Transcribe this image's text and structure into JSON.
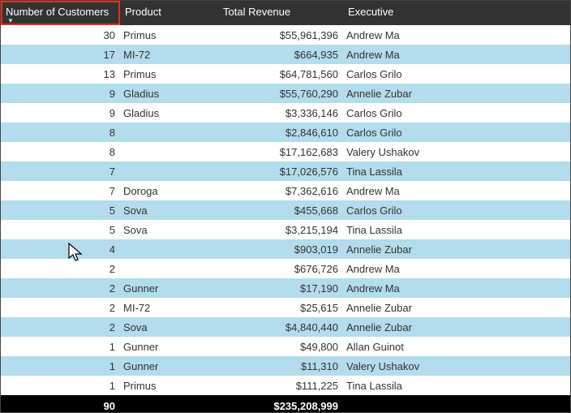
{
  "columns": {
    "num_customers": "Number of Customers",
    "product": "Product",
    "total_revenue": "Total Revenue",
    "executive": "Executive"
  },
  "rows": [
    {
      "num": "30",
      "product": "Primus",
      "revenue": "$55,961,396",
      "exec": "Andrew Ma"
    },
    {
      "num": "17",
      "product": "MI-72",
      "revenue": "$664,935",
      "exec": "Andrew Ma"
    },
    {
      "num": "13",
      "product": "Primus",
      "revenue": "$64,781,560",
      "exec": "Carlos Grilo"
    },
    {
      "num": "9",
      "product": "Gladius",
      "revenue": "$55,760,290",
      "exec": "Annelie Zubar"
    },
    {
      "num": "9",
      "product": "Gladius",
      "revenue": "$3,336,146",
      "exec": "Carlos Grilo"
    },
    {
      "num": "8",
      "product": "",
      "revenue": "$2,846,610",
      "exec": "Carlos Grilo"
    },
    {
      "num": "8",
      "product": "",
      "revenue": "$17,162,683",
      "exec": "Valery Ushakov"
    },
    {
      "num": "7",
      "product": "",
      "revenue": "$17,026,576",
      "exec": "Tina Lassila"
    },
    {
      "num": "7",
      "product": "Doroga",
      "revenue": "$7,362,616",
      "exec": "Andrew Ma"
    },
    {
      "num": "5",
      "product": "Sova",
      "revenue": "$455,668",
      "exec": "Carlos Grilo"
    },
    {
      "num": "5",
      "product": "Sova",
      "revenue": "$3,215,194",
      "exec": "Tina Lassila"
    },
    {
      "num": "4",
      "product": "",
      "revenue": "$903,019",
      "exec": "Annelie Zubar"
    },
    {
      "num": "2",
      "product": "",
      "revenue": "$676,726",
      "exec": "Andrew Ma"
    },
    {
      "num": "2",
      "product": "Gunner",
      "revenue": "$17,190",
      "exec": "Andrew Ma"
    },
    {
      "num": "2",
      "product": "MI-72",
      "revenue": "$25,615",
      "exec": "Annelie Zubar"
    },
    {
      "num": "2",
      "product": "Sova",
      "revenue": "$4,840,440",
      "exec": "Annelie Zubar"
    },
    {
      "num": "1",
      "product": "Gunner",
      "revenue": "$49,800",
      "exec": "Allan Guinot"
    },
    {
      "num": "1",
      "product": "Gunner",
      "revenue": "$11,310",
      "exec": "Valery Ushakov"
    },
    {
      "num": "1",
      "product": "Primus",
      "revenue": "$111,225",
      "exec": "Tina Lassila"
    }
  ],
  "totals": {
    "num": "90",
    "revenue": "$235,208,999"
  },
  "sort_indicator": "▼"
}
